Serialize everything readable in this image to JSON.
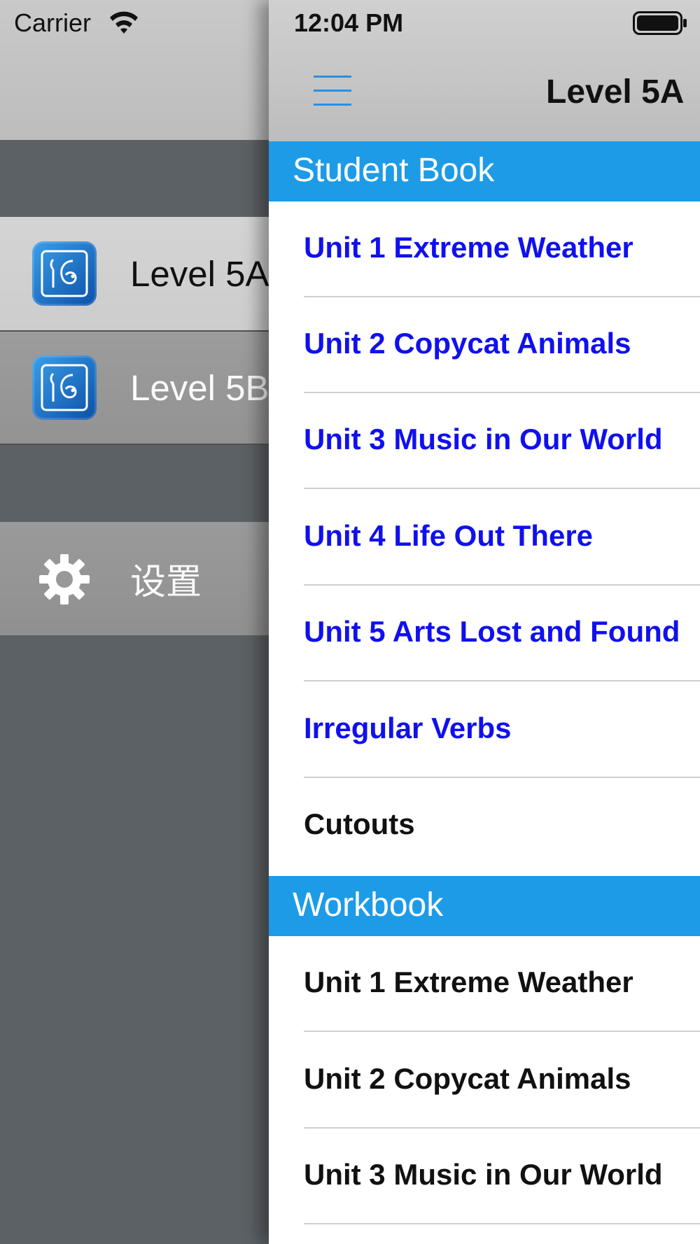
{
  "status_bar": {
    "carrier": "Carrier",
    "time": "12:04 PM"
  },
  "drawer": {
    "items": [
      {
        "label": "Level 5A",
        "icon": "app-logo-icon",
        "selected": true
      },
      {
        "label": "Level 5B",
        "icon": "app-logo-icon",
        "selected": false
      }
    ],
    "settings": {
      "label": "设置",
      "icon": "gear-icon"
    }
  },
  "header": {
    "title": "Level 5A",
    "menu_icon": "hamburger-menu-icon"
  },
  "colors": {
    "section_header": "#1e9be6",
    "link_blue": "#1010ee"
  },
  "sections": [
    {
      "title": "Student Book",
      "rows": [
        "Unit 1 Extreme Weather",
        "Unit 2 Copycat Animals",
        "Unit 3 Music in Our World",
        "Unit 4 Life Out There",
        "Unit 5 Arts Lost and Found",
        "Irregular Verbs",
        "Cutouts"
      ]
    },
    {
      "title": "Workbook",
      "rows": [
        "Unit 1 Extreme Weather",
        "Unit 2 Copycat Animals",
        "Unit 3 Music in Our World"
      ]
    }
  ]
}
